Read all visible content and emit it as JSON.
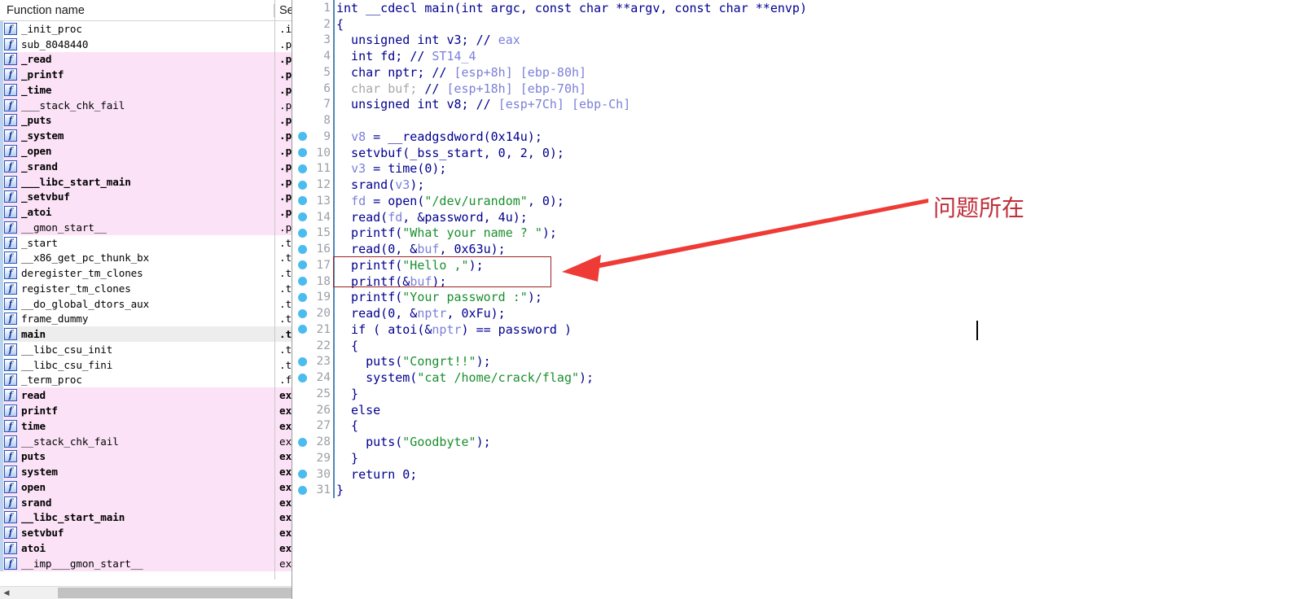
{
  "functions_panel": {
    "headers": {
      "name": "Function name",
      "segment": "Se"
    },
    "icon": "function-icon",
    "icon_glyph": "f",
    "rows": [
      {
        "name": "_init_proc",
        "segment": ".in",
        "kind": "normal"
      },
      {
        "name": "sub_8048440",
        "segment": ".pl",
        "kind": "normal"
      },
      {
        "name": "_read",
        "segment": ".p",
        "kind": "import"
      },
      {
        "name": "_printf",
        "segment": ".p",
        "kind": "import"
      },
      {
        "name": "_time",
        "segment": ".p",
        "kind": "import"
      },
      {
        "name": "___stack_chk_fail",
        "segment": ".pl",
        "kind": "import-thin"
      },
      {
        "name": "_puts",
        "segment": ".p",
        "kind": "import"
      },
      {
        "name": "_system",
        "segment": ".p",
        "kind": "import"
      },
      {
        "name": "_open",
        "segment": ".p",
        "kind": "import"
      },
      {
        "name": "_srand",
        "segment": ".p",
        "kind": "import"
      },
      {
        "name": "___libc_start_main",
        "segment": ".p",
        "kind": "import"
      },
      {
        "name": "_setvbuf",
        "segment": ".p",
        "kind": "import"
      },
      {
        "name": "_atoi",
        "segment": ".p",
        "kind": "import"
      },
      {
        "name": "__gmon_start__",
        "segment": ".pl",
        "kind": "import-thin"
      },
      {
        "name": "_start",
        "segment": ".te",
        "kind": "normal"
      },
      {
        "name": "__x86_get_pc_thunk_bx",
        "segment": ".te",
        "kind": "normal"
      },
      {
        "name": "deregister_tm_clones",
        "segment": ".te",
        "kind": "normal"
      },
      {
        "name": "register_tm_clones",
        "segment": ".te",
        "kind": "normal"
      },
      {
        "name": "__do_global_dtors_aux",
        "segment": ".te",
        "kind": "normal"
      },
      {
        "name": "frame_dummy",
        "segment": ".te",
        "kind": "normal"
      },
      {
        "name": "main",
        "segment": ".t",
        "kind": "selected"
      },
      {
        "name": "__libc_csu_init",
        "segment": ".te",
        "kind": "normal"
      },
      {
        "name": "__libc_csu_fini",
        "segment": ".te",
        "kind": "normal"
      },
      {
        "name": "_term_proc",
        "segment": ".fi",
        "kind": "normal"
      },
      {
        "name": "read",
        "segment": "ex",
        "kind": "import"
      },
      {
        "name": "printf",
        "segment": "ex",
        "kind": "import"
      },
      {
        "name": "time",
        "segment": "ex",
        "kind": "import"
      },
      {
        "name": "__stack_chk_fail",
        "segment": "ext",
        "kind": "import-thin"
      },
      {
        "name": "puts",
        "segment": "ex",
        "kind": "import"
      },
      {
        "name": "system",
        "segment": "ex",
        "kind": "import"
      },
      {
        "name": "open",
        "segment": "ex",
        "kind": "import"
      },
      {
        "name": "srand",
        "segment": "ex",
        "kind": "import"
      },
      {
        "name": "__libc_start_main",
        "segment": "ex",
        "kind": "import"
      },
      {
        "name": "setvbuf",
        "segment": "ex",
        "kind": "import"
      },
      {
        "name": "atoi",
        "segment": "ex",
        "kind": "import"
      },
      {
        "name": "__imp___gmon_start__",
        "segment": "ext",
        "kind": "import-thin"
      }
    ],
    "scrollbar": {
      "left_arrow": "◀",
      "right_arrow": "▶"
    }
  },
  "code_panel": {
    "lines": [
      {
        "n": "1",
        "bp": false,
        "segs": [
          {
            "t": "int __cdecl main(int argc, const char **argv, const char **envp)",
            "c": "plain"
          }
        ]
      },
      {
        "n": "2",
        "bp": false,
        "segs": [
          {
            "t": "{",
            "c": "plain"
          }
        ]
      },
      {
        "n": "3",
        "bp": false,
        "segs": [
          {
            "t": "  unsigned int v3; ",
            "c": "plain"
          },
          {
            "t": "// ",
            "c": "plain"
          },
          {
            "t": "eax",
            "c": "var"
          }
        ]
      },
      {
        "n": "4",
        "bp": false,
        "segs": [
          {
            "t": "  int fd; ",
            "c": "plain"
          },
          {
            "t": "// ",
            "c": "plain"
          },
          {
            "t": "ST14_4",
            "c": "var"
          }
        ]
      },
      {
        "n": "5",
        "bp": false,
        "segs": [
          {
            "t": "  char nptr; ",
            "c": "plain"
          },
          {
            "t": "// ",
            "c": "plain"
          },
          {
            "t": "[esp+8h] [ebp-80h]",
            "c": "var"
          }
        ]
      },
      {
        "n": "6",
        "bp": false,
        "segs": [
          {
            "t": "  char buf; ",
            "c": "dim"
          },
          {
            "t": "// ",
            "c": "plain"
          },
          {
            "t": "[esp+18h] [ebp-70h]",
            "c": "var"
          }
        ]
      },
      {
        "n": "7",
        "bp": false,
        "segs": [
          {
            "t": "  unsigned int v8; ",
            "c": "plain"
          },
          {
            "t": "// ",
            "c": "plain"
          },
          {
            "t": "[esp+7Ch] [ebp-Ch]",
            "c": "var"
          }
        ]
      },
      {
        "n": "8",
        "bp": false,
        "segs": [
          {
            "t": "",
            "c": "plain"
          }
        ]
      },
      {
        "n": "9",
        "bp": true,
        "segs": [
          {
            "t": "  ",
            "c": "plain"
          },
          {
            "t": "v8",
            "c": "var"
          },
          {
            "t": " = __readgsdword(0x14u);",
            "c": "plain"
          }
        ]
      },
      {
        "n": "10",
        "bp": true,
        "segs": [
          {
            "t": "  setvbuf(_bss_start, 0, 2, 0);",
            "c": "plain"
          }
        ]
      },
      {
        "n": "11",
        "bp": true,
        "segs": [
          {
            "t": "  ",
            "c": "plain"
          },
          {
            "t": "v3",
            "c": "var"
          },
          {
            "t": " = time(0);",
            "c": "plain"
          }
        ]
      },
      {
        "n": "12",
        "bp": true,
        "segs": [
          {
            "t": "  srand(",
            "c": "plain"
          },
          {
            "t": "v3",
            "c": "var"
          },
          {
            "t": ");",
            "c": "plain"
          }
        ]
      },
      {
        "n": "13",
        "bp": true,
        "segs": [
          {
            "t": "  ",
            "c": "plain"
          },
          {
            "t": "fd",
            "c": "var"
          },
          {
            "t": " = open(",
            "c": "plain"
          },
          {
            "t": "\"/dev/urandom\"",
            "c": "str"
          },
          {
            "t": ", 0);",
            "c": "plain"
          }
        ]
      },
      {
        "n": "14",
        "bp": true,
        "segs": [
          {
            "t": "  read(",
            "c": "plain"
          },
          {
            "t": "fd",
            "c": "var"
          },
          {
            "t": ", &password, 4u);",
            "c": "plain"
          }
        ]
      },
      {
        "n": "15",
        "bp": true,
        "segs": [
          {
            "t": "  printf(",
            "c": "plain"
          },
          {
            "t": "\"What your name ? \"",
            "c": "str"
          },
          {
            "t": ");",
            "c": "plain"
          }
        ]
      },
      {
        "n": "16",
        "bp": true,
        "segs": [
          {
            "t": "  read(0, &",
            "c": "plain"
          },
          {
            "t": "buf",
            "c": "var"
          },
          {
            "t": ", 0x63u);",
            "c": "plain"
          }
        ]
      },
      {
        "n": "17",
        "bp": true,
        "segs": [
          {
            "t": "  printf(",
            "c": "plain"
          },
          {
            "t": "\"Hello ,\"",
            "c": "str"
          },
          {
            "t": ");",
            "c": "plain"
          }
        ]
      },
      {
        "n": "18",
        "bp": true,
        "segs": [
          {
            "t": "  printf(&",
            "c": "plain"
          },
          {
            "t": "buf",
            "c": "var"
          },
          {
            "t": ");",
            "c": "plain"
          }
        ]
      },
      {
        "n": "19",
        "bp": true,
        "segs": [
          {
            "t": "  printf(",
            "c": "plain"
          },
          {
            "t": "\"Your password :\"",
            "c": "str"
          },
          {
            "t": ");",
            "c": "plain"
          }
        ]
      },
      {
        "n": "20",
        "bp": true,
        "segs": [
          {
            "t": "  read(0, &",
            "c": "plain"
          },
          {
            "t": "nptr",
            "c": "var"
          },
          {
            "t": ", 0xFu);",
            "c": "plain"
          }
        ]
      },
      {
        "n": "21",
        "bp": true,
        "segs": [
          {
            "t": "  if ( atoi(&",
            "c": "plain"
          },
          {
            "t": "nptr",
            "c": "var"
          },
          {
            "t": ") == password )",
            "c": "plain"
          }
        ]
      },
      {
        "n": "22",
        "bp": false,
        "segs": [
          {
            "t": "  {",
            "c": "plain"
          }
        ]
      },
      {
        "n": "23",
        "bp": true,
        "segs": [
          {
            "t": "    puts(",
            "c": "plain"
          },
          {
            "t": "\"Congrt!!\"",
            "c": "str"
          },
          {
            "t": ");",
            "c": "plain"
          }
        ]
      },
      {
        "n": "24",
        "bp": true,
        "segs": [
          {
            "t": "    system(",
            "c": "plain"
          },
          {
            "t": "\"cat /home/crack/flag\"",
            "c": "str"
          },
          {
            "t": ");",
            "c": "plain"
          }
        ]
      },
      {
        "n": "25",
        "bp": false,
        "segs": [
          {
            "t": "  }",
            "c": "plain"
          }
        ]
      },
      {
        "n": "26",
        "bp": false,
        "segs": [
          {
            "t": "  else",
            "c": "plain"
          }
        ]
      },
      {
        "n": "27",
        "bp": false,
        "segs": [
          {
            "t": "  {",
            "c": "plain"
          }
        ]
      },
      {
        "n": "28",
        "bp": true,
        "segs": [
          {
            "t": "    puts(",
            "c": "plain"
          },
          {
            "t": "\"Goodbyte\"",
            "c": "str"
          },
          {
            "t": ");",
            "c": "plain"
          }
        ]
      },
      {
        "n": "29",
        "bp": false,
        "segs": [
          {
            "t": "  }",
            "c": "plain"
          }
        ]
      },
      {
        "n": "30",
        "bp": true,
        "segs": [
          {
            "t": "  return 0;",
            "c": "plain"
          }
        ]
      },
      {
        "n": "31",
        "bp": true,
        "segs": [
          {
            "t": "}",
            "c": "plain"
          }
        ]
      }
    ]
  },
  "annotation": {
    "text": "问题所在",
    "color": "#c0303a",
    "box_color": "#9c2222",
    "arrow_color": "#ef3b36"
  }
}
